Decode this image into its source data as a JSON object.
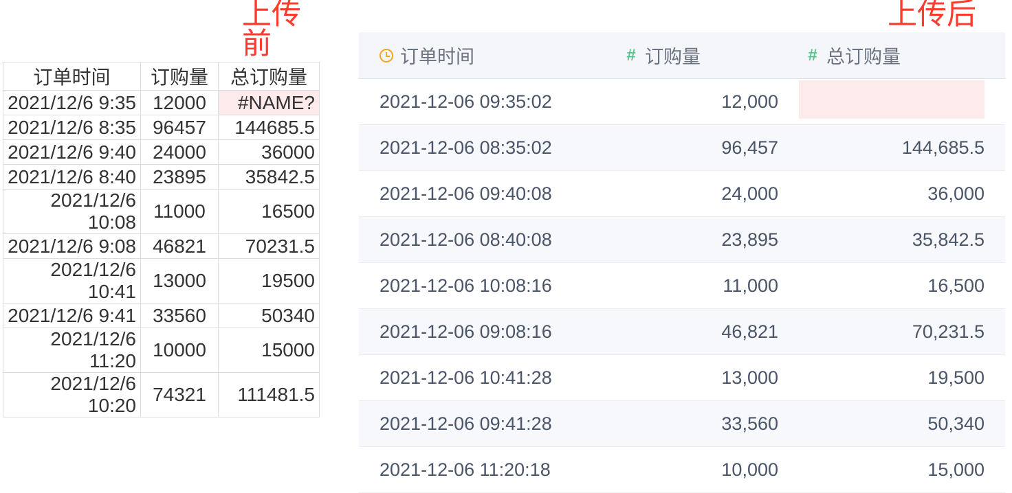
{
  "labels": {
    "before": "上传前",
    "after": "上传后"
  },
  "sheet": {
    "headers": [
      "订单时间",
      "订购量",
      "总订购量"
    ],
    "rows": [
      {
        "time": "2021/12/6 9:35",
        "qty": "12000",
        "total": "#NAME?",
        "error": true
      },
      {
        "time": "2021/12/6 8:35",
        "qty": "96457",
        "total": "144685.5"
      },
      {
        "time": "2021/12/6 9:40",
        "qty": "24000",
        "total": "36000"
      },
      {
        "time": "2021/12/6 8:40",
        "qty": "23895",
        "total": "35842.5"
      },
      {
        "time": "2021/12/6 10:08",
        "qty": "11000",
        "total": "16500"
      },
      {
        "time": "2021/12/6 9:08",
        "qty": "46821",
        "total": "70231.5"
      },
      {
        "time": "2021/12/6 10:41",
        "qty": "13000",
        "total": "19500"
      },
      {
        "time": "2021/12/6 9:41",
        "qty": "33560",
        "total": "50340"
      },
      {
        "time": "2021/12/6 11:20",
        "qty": "10000",
        "total": "15000"
      },
      {
        "time": "2021/12/6 10:20",
        "qty": "74321",
        "total": "111481.5"
      }
    ]
  },
  "datatable": {
    "headers": [
      "订单时间",
      "订购量",
      "总订购量"
    ],
    "col_types": [
      "time",
      "number",
      "number"
    ],
    "hash_glyph": "#",
    "rows": [
      {
        "time": "2021-12-06 09:35:02",
        "qty": "12,000",
        "total": "",
        "error": true
      },
      {
        "time": "2021-12-06 08:35:02",
        "qty": "96,457",
        "total": "144,685.5"
      },
      {
        "time": "2021-12-06 09:40:08",
        "qty": "24,000",
        "total": "36,000"
      },
      {
        "time": "2021-12-06 08:40:08",
        "qty": "23,895",
        "total": "35,842.5"
      },
      {
        "time": "2021-12-06 10:08:16",
        "qty": "11,000",
        "total": "16,500"
      },
      {
        "time": "2021-12-06 09:08:16",
        "qty": "46,821",
        "total": "70,231.5"
      },
      {
        "time": "2021-12-06 10:41:28",
        "qty": "13,000",
        "total": "19,500"
      },
      {
        "time": "2021-12-06 09:41:28",
        "qty": "33,560",
        "total": "50,340"
      },
      {
        "time": "2021-12-06 11:20:18",
        "qty": "10,000",
        "total": "15,000"
      }
    ]
  }
}
